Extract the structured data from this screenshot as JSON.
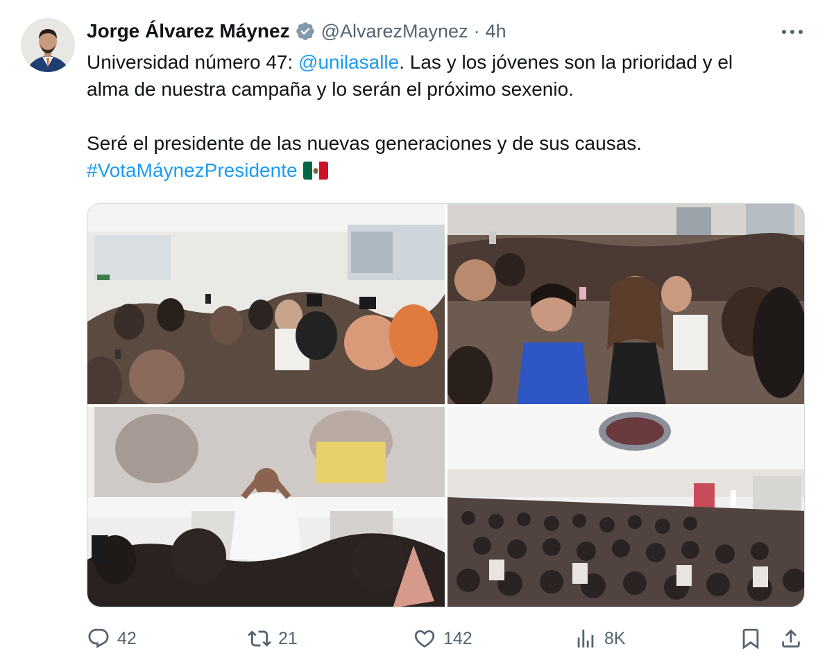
{
  "author": {
    "name": "Jorge Álvarez Máynez",
    "handle": "@AlvarezMaynez",
    "separator": "·",
    "time": "4h",
    "verified": true
  },
  "tweet": {
    "line1_prefix": "Universidad número 47: ",
    "line1_mention": "@unilasalle",
    "line1_suffix": ". Las y los jóvenes son la prioridad y el",
    "line2": "alma de nuestra campaña y lo serán el próximo sexenio.",
    "line3": "Seré el presidente de las nuevas generaciones y de sus causas.",
    "hashtag": "#VotaMáynezPresidente",
    "flag_emoji": "mexico-flag"
  },
  "metrics": {
    "replies": "42",
    "retweets": "21",
    "likes": "142",
    "views": "8K"
  },
  "colors": {
    "text": "#0f1419",
    "secondary": "#536471",
    "link": "#1d9bf0",
    "border": "#cfd9de"
  }
}
